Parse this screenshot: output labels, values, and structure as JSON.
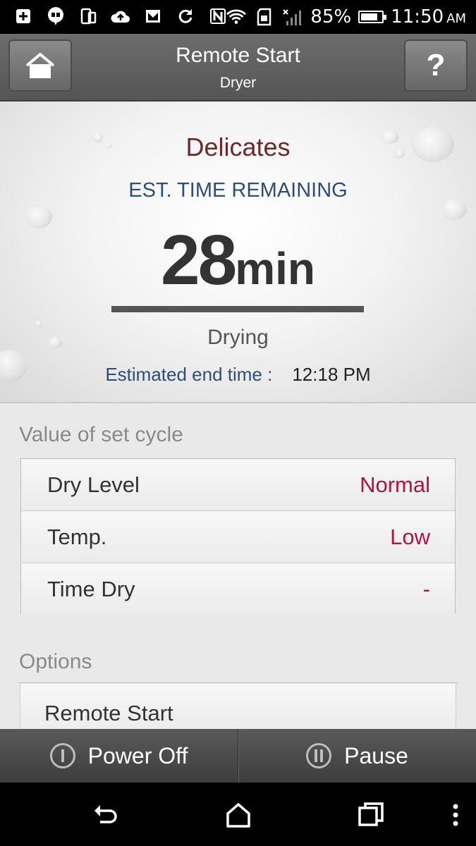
{
  "status_bar": {
    "battery_text": "85%",
    "battery_level": 0.85,
    "time": "11:50",
    "ampm": "AM",
    "icons": [
      "add-icon",
      "hangouts-icon",
      "device-icon",
      "cloud-upload-icon",
      "mail-icon",
      "sync-icon",
      "nfc-icon",
      "wifi-icon",
      "sd-card-icon",
      "no-signal-icon"
    ]
  },
  "header": {
    "title": "Remote Start",
    "subtitle": "Dryer",
    "help_label": "?"
  },
  "status_panel": {
    "course": "Delicates",
    "est_label": "EST. TIME REMAINING",
    "time_value": "28",
    "time_unit": "min",
    "progress": 1.0,
    "state": "Drying",
    "end_time_label": "Estimated end time :",
    "end_time_value": "12:18 PM"
  },
  "cycle": {
    "title": "Value of set cycle",
    "rows": [
      {
        "label": "Dry Level",
        "value": "Normal"
      },
      {
        "label": "Temp.",
        "value": "Low"
      },
      {
        "label": "Time Dry",
        "value": "-"
      }
    ]
  },
  "options": {
    "title": "Options",
    "items": [
      "Remote Start"
    ]
  },
  "actions": {
    "power_off": "Power Off",
    "pause": "Pause"
  },
  "colors": {
    "course": "#6b2a2a",
    "label_blue": "#2e4d78",
    "value_accent": "#b0124a",
    "header_bg": "#5f5f5f"
  }
}
